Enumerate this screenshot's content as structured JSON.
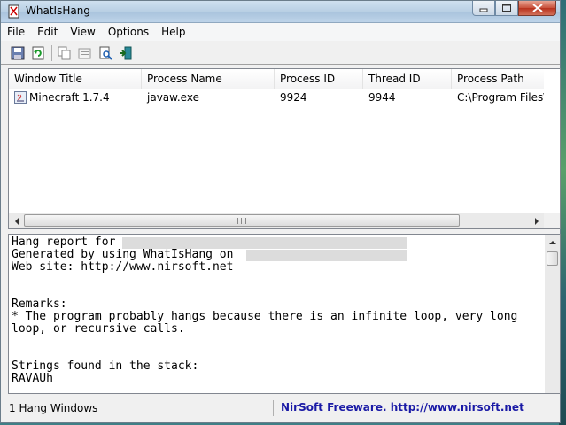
{
  "window": {
    "title": "WhatIsHang"
  },
  "menu": [
    "File",
    "Edit",
    "View",
    "Options",
    "Help"
  ],
  "toolbar": {
    "icons": [
      "save-icon",
      "refresh-icon",
      "copy-icon",
      "properties-icon",
      "find-icon",
      "exit-icon"
    ]
  },
  "list": {
    "columns": [
      "Window Title",
      "Process Name",
      "Process ID",
      "Thread ID",
      "Process Path"
    ],
    "rows": [
      {
        "window_title": "Minecraft 1.7.4",
        "process_name": "javaw.exe",
        "process_id": "9924",
        "thread_id": "9944",
        "process_path": "C:\\Program Files\\Java\\"
      }
    ]
  },
  "report": {
    "lines": [
      "Hang report for",
      "Generated by using WhatIsHang on",
      "Web site: http://www.nirsoft.net",
      "",
      "",
      "Remarks:",
      "* The program probably hangs because there is an infinite loop, very long loop, or recursive calls.",
      "",
      "",
      "Strings found in the stack:",
      "RAVAUh"
    ]
  },
  "status": {
    "count": "1 Hang Windows",
    "link": "NirSoft Freeware.  http://www.nirsoft.net"
  },
  "colors": {
    "link": "#1a1aa6",
    "close_button": "#c8503a"
  }
}
